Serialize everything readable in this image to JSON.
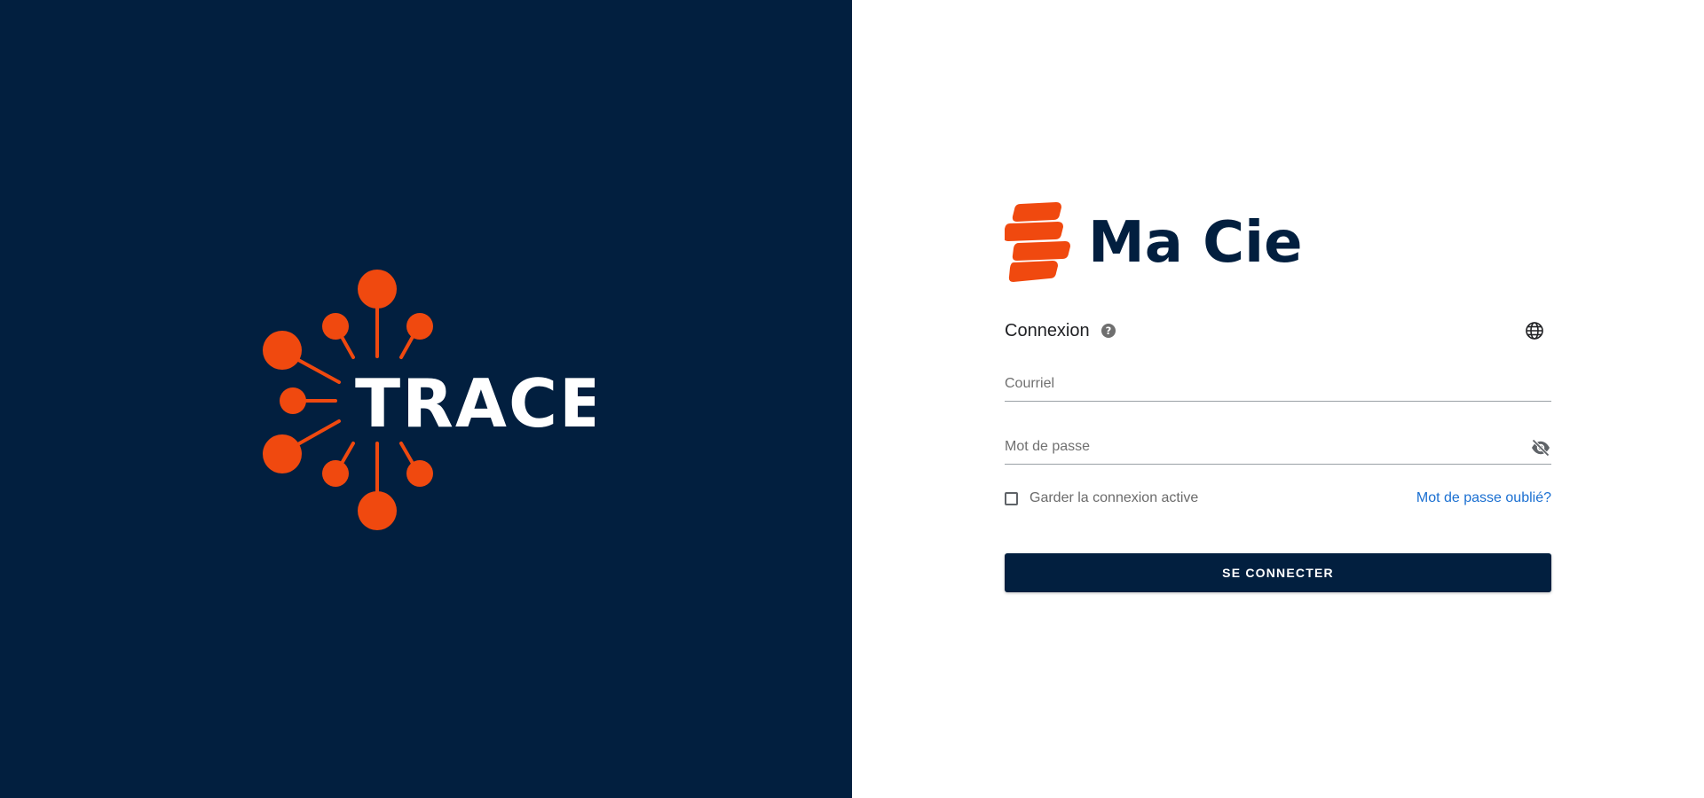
{
  "colors": {
    "navy": "#021f3f",
    "accent": "#f0490f",
    "link": "#1a6fd1"
  },
  "left": {
    "logo_text": "TRACE"
  },
  "brand": {
    "name": "Ma Cie",
    "mark_icon": "stacked-bars-logo"
  },
  "login": {
    "title": "Connexion",
    "help_icon": "question-circle-icon",
    "language_icon": "globe-icon",
    "email_placeholder": "Courriel",
    "password_placeholder": "Mot de passe",
    "password_visibility_icon": "eye-off-icon",
    "remember_label": "Garder la connexion active",
    "forgot_label": "Mot de passe oublié?",
    "submit_label": "SE CONNECTER"
  }
}
